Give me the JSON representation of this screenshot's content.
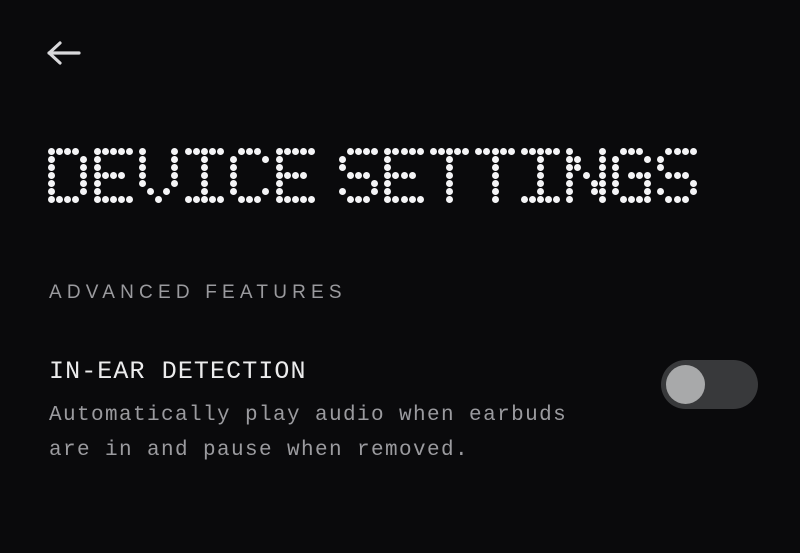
{
  "theme": {
    "background": "#0a0a0c",
    "title_dot_color": "#f4f4f6",
    "section_header_color": "#9a9a9e",
    "setting_title_color": "#ececed",
    "description_color": "#9b9b9f",
    "toggle_track_off": "#38393b",
    "toggle_knob_off": "#a8a9aa",
    "back_arrow_color": "#d9d9dc"
  },
  "nav": {
    "back_icon": "arrow-left-icon",
    "back_label": "Back"
  },
  "header": {
    "title": "DEVICE SETTINGS"
  },
  "sections": [
    {
      "header": "ADVANCED FEATURES",
      "settings": [
        {
          "title": "IN-EAR DETECTION",
          "description": "Automatically play audio when earbuds are in and pause when removed.",
          "toggle": {
            "state": "off",
            "state_label": "Off"
          }
        }
      ]
    }
  ]
}
